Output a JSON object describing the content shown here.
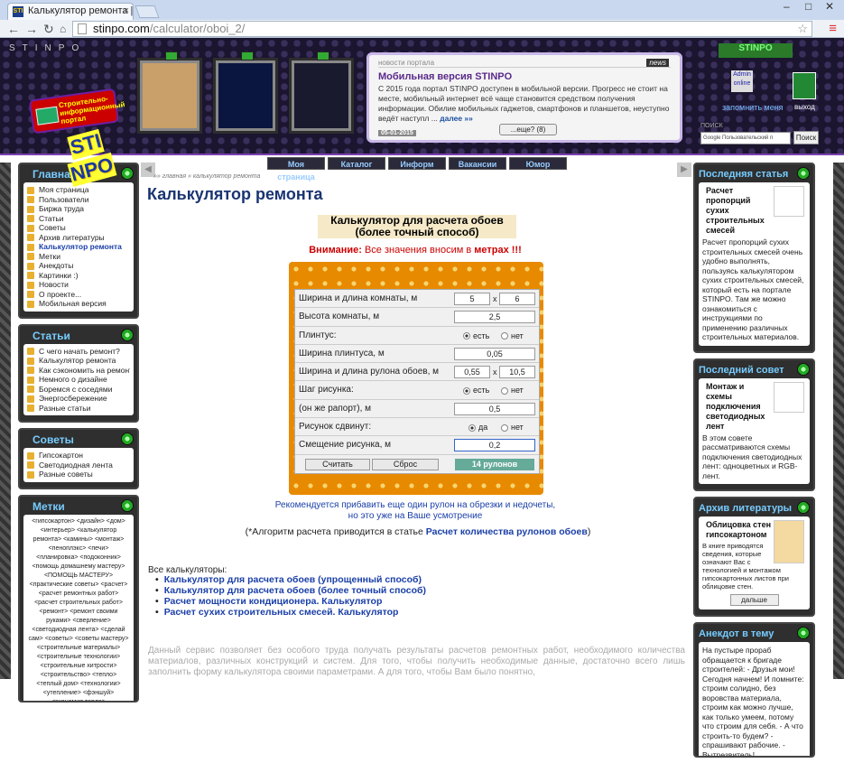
{
  "browser": {
    "tab_title": "Калькулятор ремонта | Стр",
    "url_domain": "stinpo.com",
    "url_path": "/calculator/oboi_2/"
  },
  "header": {
    "site_name": "STINPO",
    "logo_text": "Строительно-информационный портал",
    "news_label": "новости портала",
    "news_badge": "news",
    "news_title": "Мобильная версия STINPO",
    "news_body": "С 2015 года портал STINPO доступен в мобильной версии. Прогресс не стоит на месте, мобильный интернет всё чаще становится средством получения информации. Обилие мобильных гаджетов, смартфонов и планшетов, неуступно ведёт наступл ...",
    "news_more_link": "далее »»",
    "news_date": "05-01-2015",
    "news_more_btn": "...еще? (8)",
    "login_badge": "STINPO",
    "admin_text": "Admin online",
    "remember": "запомнить меня",
    "exit": "выход",
    "search_label": "ПОИСК",
    "search_placeholder": "Google Пользовательский п",
    "search_btn": "Поиск"
  },
  "topnav": [
    "Моя страница",
    "Каталог",
    "Информ",
    "Вакансии",
    "Юмор"
  ],
  "breadcrumb": "»» главная » калькулятор ремонта",
  "left": {
    "main_title": "Главная",
    "main_items": [
      "Моя страница",
      "Пользователи",
      "Биржа труда",
      "Статьи",
      "Советы",
      "Архив литературы",
      "Калькулятор ремонта",
      "Метки",
      "Анекдоты",
      "Картинки :)",
      "Новости",
      "О проекте...",
      "Мобильная версия"
    ],
    "articles_title": "Статьи",
    "articles_items": [
      "С чего начать ремонт?",
      "Калькулятор ремонта",
      "Как сэкономить на ремонте?",
      "Немного о дизайне",
      "Боремся с соседями",
      "Энергосбережение",
      "Разные статьи"
    ],
    "tips_title": "Советы",
    "tips_items": [
      "Гипсокартон",
      "Светодиодная лента",
      "Разные советы"
    ],
    "tags_title": "Метки",
    "tags_text": "<гипсокартон> <дизайн> <дом> <интерьер> <калькулятор ремонта> <камины> <монтаж> <пеноплэкс> <печи> <планировка> <подоконник> <помощь домашнему мастеру> <ПОМОЩЬ МАСТЕРУ> <практические советы> <расчет> <расчет ремонтных работ> <расчет строительных работ> <ремонт> <ремонт своими руками> <сверление> <светодиодная лента> <сделай сам> <советы> <советы мастеру> <строительные материалы> <строительные технологии> <строительные хитрости> <строительство> <тепло> <теплый дом> <технологии> <утепление> <фэншуй> <экономия тепла> <энергосбережение> <энергосберегающие технологии> <энергосбережения>"
  },
  "main": {
    "title": "Калькулятор ремонта",
    "calc_title_1": "Калькулятор для расчета обоев",
    "calc_title_2": "(более точный способ)",
    "warn_label": "Внимание:",
    "warn_text": "Все значения вносим в",
    "warn_unit": "метрах",
    "warn_end": "!!!",
    "form": {
      "room_wl_label": "Ширина и длина комнаты, м",
      "room_w": "5",
      "room_l": "6",
      "height_label": "Высота комнаты, м",
      "height": "2,5",
      "plinth_label": "Плинтус:",
      "yes": "есть",
      "no": "нет",
      "plinth_w_label": "Ширина плинтуса, м",
      "plinth_w": "0,05",
      "roll_label": "Ширина и длина рулона обоев, м",
      "roll_w": "0,55",
      "roll_l": "10,5",
      "step_label": "Шаг рисунка:",
      "rapport_label": "(он же рапорт), м",
      "rapport": "0,5",
      "shift_label": "Рисунок сдвинут:",
      "da": "да",
      "offset_label": "Смещение рисунка, м",
      "offset": "0,2",
      "calc_btn": "Считать",
      "reset_btn": "Сброс",
      "result": "14 рулонов"
    },
    "rec_1": "Рекомендуется прибавить еще один рулон на обрезки и недочеты,",
    "rec_2": "но это уже на Ваше усмотрение",
    "algo_text": "(*Алгоритм расчета приводится в статье",
    "algo_link": "Расчет количества рулонов обоев",
    "algo_end": ")",
    "all_calc": "Все калькуляторы:",
    "calc_links": [
      "Калькулятор для расчета обоев (упрощенный способ)",
      "Калькулятор для расчета обоев (более точный способ)",
      "Расчет мощности кондиционера. Калькулятор",
      "Расчет сухих строительных смесей. Калькулятор"
    ],
    "desc": "Данный сервис позволяет без особого труда получать результаты расчетов ремонтных работ, необходимого количества материалов, различных конструкций и систем. Для того, чтобы получить необходимые данные, достаточно всего лишь заполнить форму калькулятора своими параметрами. А для того, чтобы Вам было понятно,"
  },
  "right": {
    "a_title": "Последняя статья",
    "a_head": "Расчет пропорций сухих строительных смесей",
    "a_body": "Расчет пропорций сухих строительных смесей очень удобно выполнять, пользуясь калькулятором сухих строительных смесей, который есть на портале STINPO. Там же можно ознакомиться с инструкциями по применению различных строительных материалов.",
    "t_title": "Последний совет",
    "t_head": "Монтаж и схемы подключения светодиодных лент",
    "t_body": "В этом совете рассматриваются схемы подключения светодиодных лент: одноцветных и RGB-лент.",
    "l_title": "Архив литературы",
    "l_head": "Облицовка стен гипсокартоном",
    "l_body": "В книге приводятся сведения, которые означают Вас с технологией и монтажом гипсокартонных листов при облицовке стен.",
    "l_btn": "дальше",
    "j_title": "Анекдот в тему",
    "j_body": "На пустыре прораб обращается к бригаде строителей: - Друзья мои! Сегодня начнем! И помните: строим солидно, без воровства материала, строим как можно лучше, как только умеем, потому что строим для себя. - А что строить-то будем? - спрашивают рабочие. - Вытрезвитель!"
  }
}
